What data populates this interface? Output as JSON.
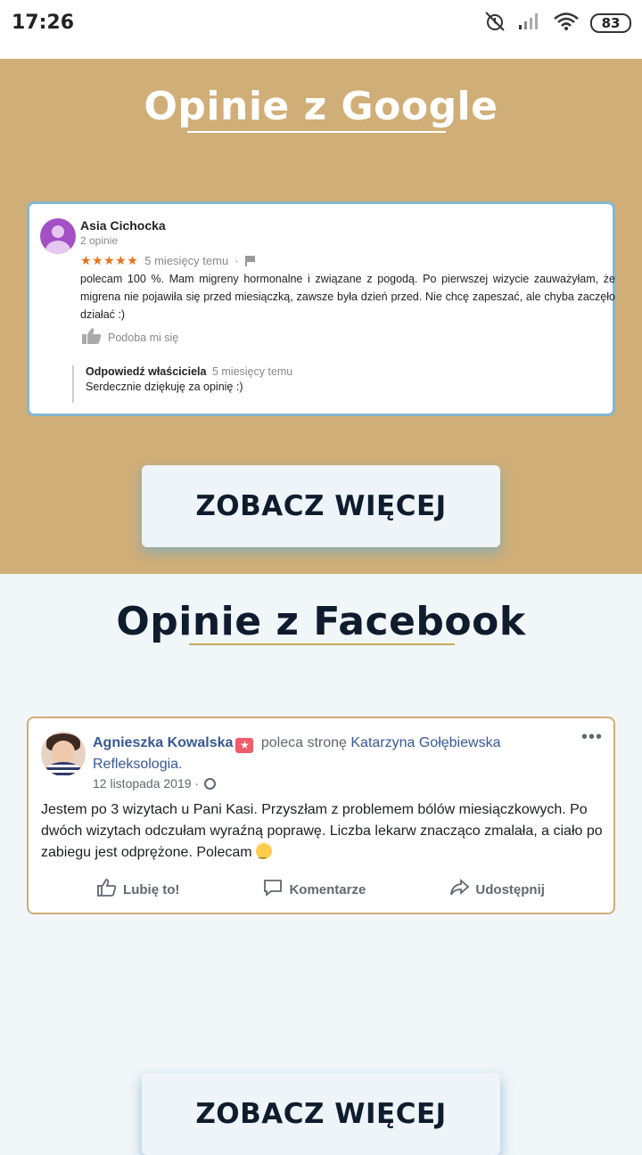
{
  "status_bar": {
    "time": "17:26",
    "battery": "83"
  },
  "google": {
    "title": "Opinie z Google",
    "review": {
      "author": "Asia Cichocka",
      "review_count": "2 opinie",
      "stars": "★★★★★",
      "time": "5 miesięcy temu",
      "separator": "·",
      "text": "polecam 100 %.  Mam migreny hormonalne i związane z pogodą. Po pierwszej wizycie zauważyłam, że migrena nie pojawiła się przed miesiączką, zawsze była dzień przed. Nie chcę zapeszać, ale chyba zaczęło działać :)",
      "like_label": "Podoba mi się",
      "owner_reply": {
        "label": "Odpowiedź właściciela",
        "time": "5 miesięcy temu",
        "text": "Serdecznie dziękuję za opinię :)"
      }
    },
    "cta": "ZOBACZ WIĘCEJ"
  },
  "facebook": {
    "title": "Opinie z Facebook",
    "review": {
      "author": "Agnieszka Kowalska",
      "recommends": "poleca stronę",
      "page_name": "Katarzyna Gołębiewska Refleksologia.",
      "date": "12 listopada 2019 ·",
      "text": "Jestem po 3 wizytach u Pani Kasi. Przyszłam z problemem bólów miesiączkowych. Po dwóch wizytach odczułam wyraźną poprawę. Liczba lekarw znacząco zmalała, a ciało po zabiegu jest odprężone. Polecam",
      "actions": {
        "like": "Lubię to!",
        "comment": "Komentarze",
        "share": "Udostępnij"
      },
      "more": "•••"
    },
    "cta": "ZOBACZ WIĘCEJ"
  }
}
